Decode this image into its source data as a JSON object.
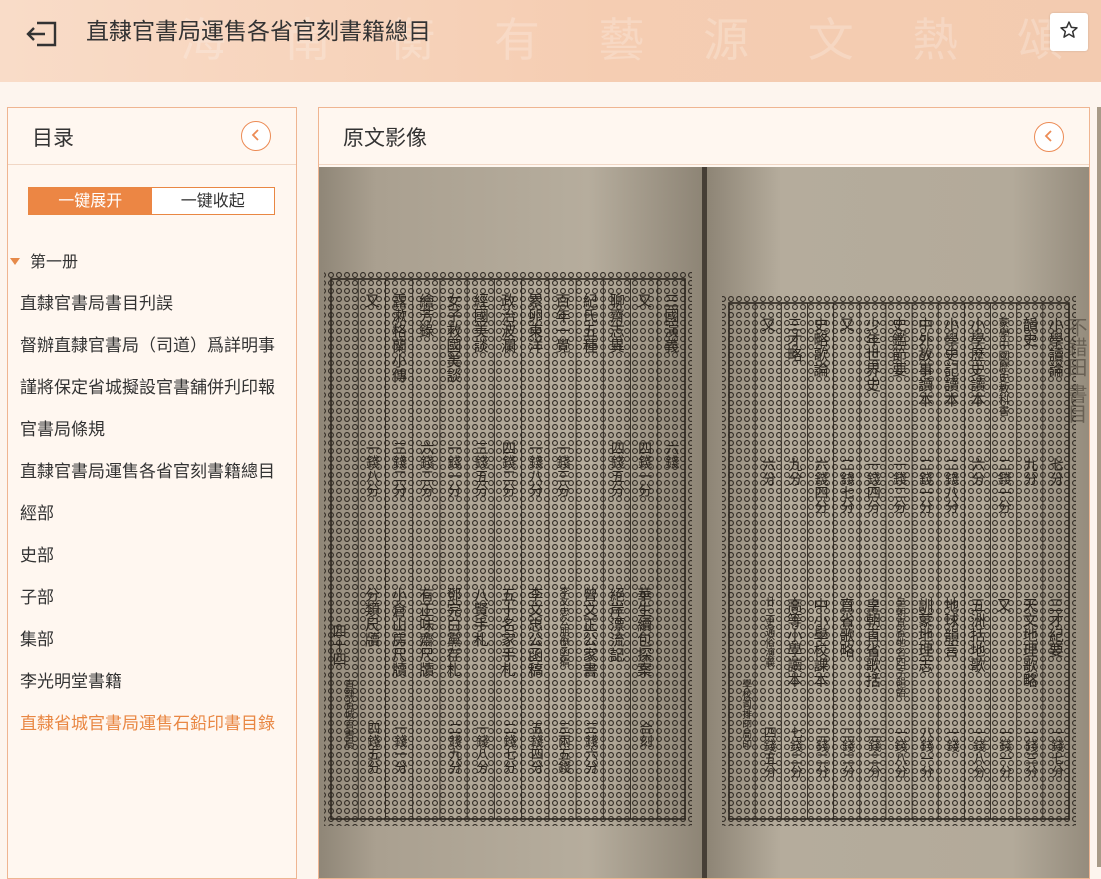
{
  "header": {
    "title": "直隸官書局運售各省官刻書籍總目",
    "watermark": "海 南 衡 有 藝 源 文 熱 頌 官 經 寶"
  },
  "toc_panel": {
    "title": "目录",
    "expand_all": "一键展开",
    "collapse_all": "一键收起",
    "volume": "第一册",
    "items": [
      "直隸官書局書目刋誤",
      "督辦直隸官書局（司道）爲詳明事",
      "謹將保定省城擬設官書舖併刋印報",
      "官書局條規",
      "直隸官書局運售各省官刻書籍總目",
      "經部",
      "史部",
      "子部",
      "集部",
      "李光明堂書籍",
      "直隸省城官書局運售石鉛印書目錄"
    ],
    "active_index": 10
  },
  "image_panel": {
    "title": "原文影像",
    "left_page": {
      "columns": [
        {
          "title": "三國演義",
          "price1": "六錢",
          "sub": "",
          "price2": ""
        },
        {
          "title": "又",
          "price1": "四錢一分",
          "sub": "華生續包探案",
          "price2": "合刻"
        },
        {
          "title": "聊齋志異",
          "price1": "四錢五分",
          "sub": "絕岸漂流記",
          "price2": ""
        },
        {
          "title": "紀氏五種",
          "price1": "",
          "sub": "曾文正公家書",
          "price2": "三錢六分"
        },
        {
          "title": "百年一覺",
          "price1": "一錢三分",
          "sub": "李文忠公朋僚函稿",
          "price2": "三兩五錢"
        },
        {
          "title": "累卵東洋",
          "price1": "一錢八分",
          "sub": "李文忠公函稿",
          "price2": "五錢四分"
        },
        {
          "title": "政治波瀾",
          "price1": "四錢二分",
          "sub": "五十名家手札",
          "price2": "二錢七分"
        },
        {
          "title": "經國美談",
          "price1": "三錢五分",
          "sub": "八賢手札",
          "price2": "一錢八分"
        },
        {
          "title": "女子救國美談",
          "price1": "一錢一分",
          "sub": "鄧完白黨存札",
          "price2": "二錢九分"
        },
        {
          "title": "繪芳錄",
          "price1": "六錢二分",
          "sub": "有正味齋尺牘",
          "price2": ""
        },
        {
          "title": "露漱格蘭小傳",
          "price1": "三錢二分",
          "sub": "小倉山房尺牘",
          "price2": "一錢一分"
        },
        {
          "title": "又",
          "price1": "一錢八分",
          "sub": "分類尺牘",
          "price2": "四錢五分"
        }
      ],
      "page_number": "四十四",
      "footer": "直隸省城官書局"
    },
    "right_page": {
      "columns": [
        {
          "title": "小學讀論",
          "price1": "七分",
          "sub": "三才紀要",
          "price2": "一錢七分"
        },
        {
          "title": "韻史",
          "price1": "九分",
          "sub": "天文地理歌略",
          "price2": "一錢三分"
        },
        {
          "title": "蒙學中國歷史教科書",
          "price1": "二錢一分",
          "sub": "又",
          "price2": "一錢一分"
        },
        {
          "title": "小學歷史讀本",
          "price1": "六分",
          "sub": "五洲括地歌",
          "price2": "一錢八分"
        },
        {
          "title": "小學史記讀本",
          "price1": "二錢八分",
          "sub": "地球韻言",
          "price2": "一錢"
        },
        {
          "title": "中外故事讀本",
          "price1": "二錢一分",
          "sub": "訓蒙地理志",
          "price2": "八錢一分"
        },
        {
          "title": "史鑑節要",
          "price1": "一錢二分",
          "sub": "皇朝直省地名四字韻語",
          "price2": "一錢八分"
        },
        {
          "title": "少年世界史",
          "price1": "一錢四分",
          "sub": "皇朝直省歌括",
          "price2": "二錢二分"
        },
        {
          "title": "又",
          "price1": "二錢七分",
          "sub": "直省歌略",
          "price2": "二錢二分"
        },
        {
          "title": "史略歌論",
          "price1": "六錢四分",
          "sub": "中小學校課本",
          "price2": "二錢二分"
        },
        {
          "title": "三才略",
          "price1": "九分",
          "sub": "高等小學讀本",
          "price2": "七錢二分"
        },
        {
          "title": "又",
          "price1": "六分",
          "sub": "廿二史通俗演義",
          "price2": "四錢五分"
        }
      ],
      "page_number": "",
      "footer": "學校司排印局印"
    },
    "ghost_text": "不錯田 書目"
  },
  "colors": {
    "accent": "#ec8644",
    "border": "#efb591",
    "header_bg": "#f7d3ba",
    "paper": "#b5ab9b",
    "ink": "#2b251e"
  }
}
